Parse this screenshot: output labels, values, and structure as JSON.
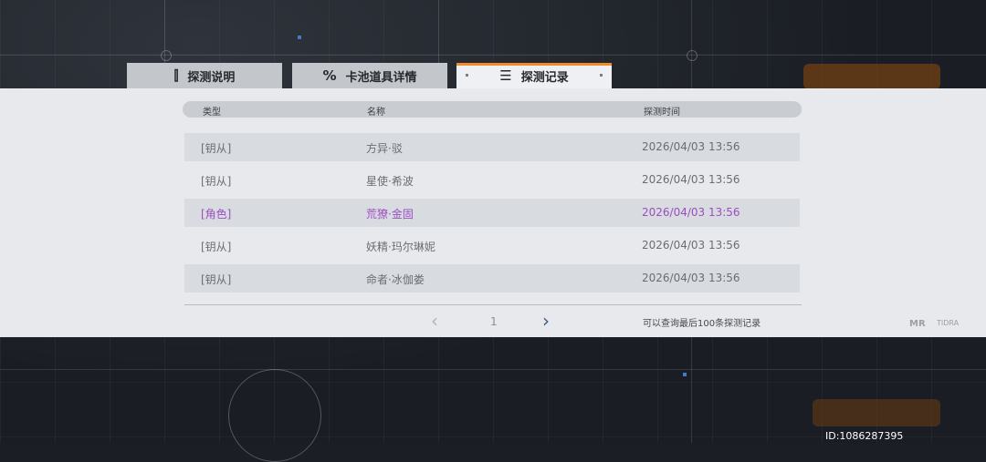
{
  "tabs": [
    {
      "label": "探测说明",
      "icon": "info-book-icon",
      "glyph": "⫿"
    },
    {
      "label": "卡池道具详情",
      "icon": "percent-icon",
      "glyph": "%"
    },
    {
      "label": "探测记录",
      "icon": "list-icon",
      "glyph": "☰"
    }
  ],
  "columns": {
    "type": "类型",
    "name": "名称",
    "time": "探测时间"
  },
  "rows": [
    {
      "type": "[钥从]",
      "name": "方异·驳",
      "time": "2026/04/03 13:56",
      "rarity": "normal"
    },
    {
      "type": "[钥从]",
      "name": "星使·希波",
      "time": "2026/04/03 13:56",
      "rarity": "normal"
    },
    {
      "type": "[角色]",
      "name": "荒獠·金固",
      "time": "2026/04/03 13:56",
      "rarity": "role"
    },
    {
      "type": "[钥从]",
      "name": "妖精·玛尔琳妮",
      "time": "2026/04/03 13:56",
      "rarity": "normal"
    },
    {
      "type": "[钥从]",
      "name": "命者·冰伽娄",
      "time": "2026/04/03 13:56",
      "rarity": "normal"
    }
  ],
  "pager": {
    "prev": "‹",
    "page": "1",
    "next": "›"
  },
  "note": "可以查询最后100条探测记录",
  "brand": {
    "logo_a": "MR",
    "logo_b": "TIDRA"
  },
  "id_label": "ID:1086287395",
  "colors": {
    "accent": "#f08a2a",
    "role": "#9b4fc0",
    "panel": "#e7e9ec"
  }
}
